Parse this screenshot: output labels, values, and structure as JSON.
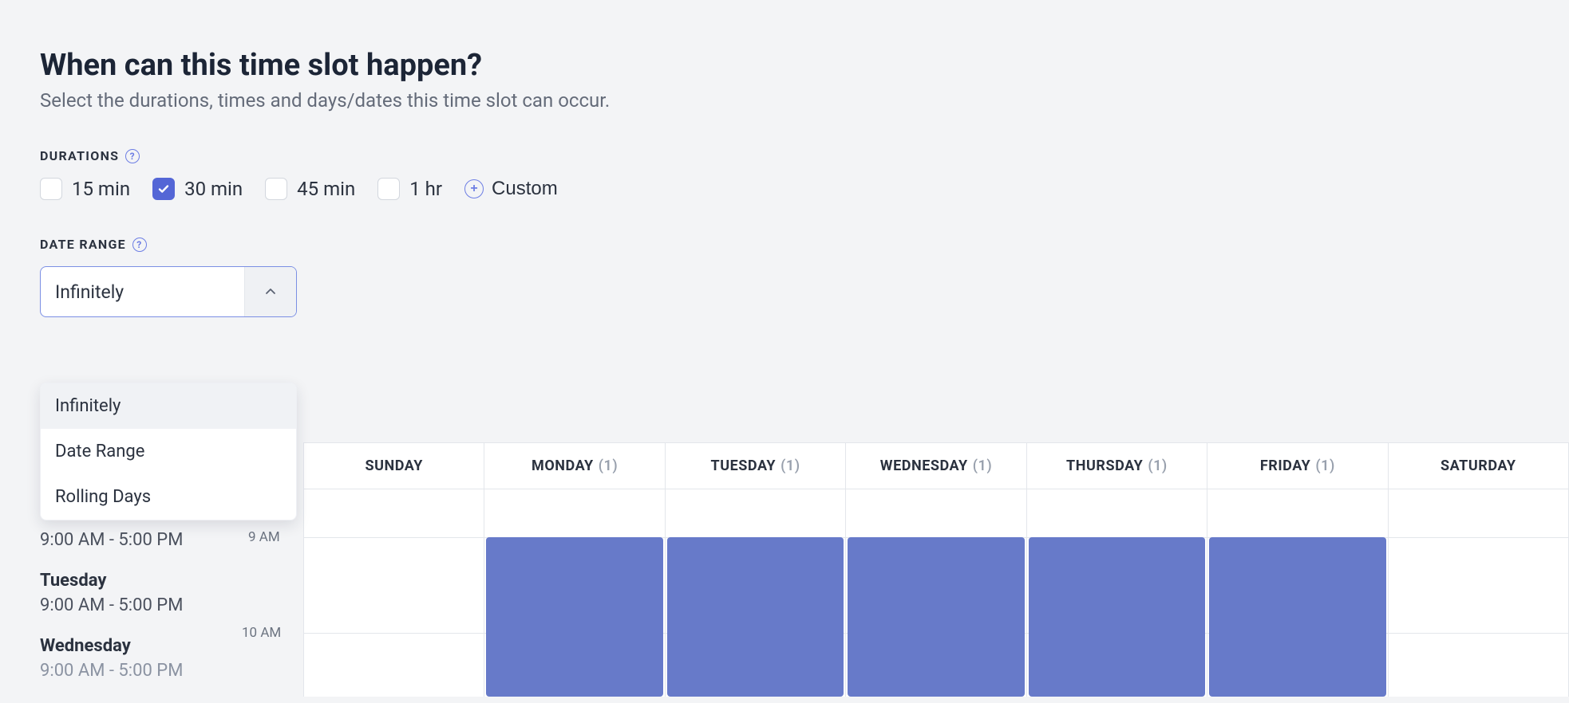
{
  "header": {
    "title": "When can this time slot happen?",
    "subtitle": "Select the durations, times and days/dates this time slot can occur."
  },
  "durations": {
    "label": "DURATIONS",
    "options": [
      {
        "label": "15 min",
        "checked": false
      },
      {
        "label": "30 min",
        "checked": true
      },
      {
        "label": "45 min",
        "checked": false
      },
      {
        "label": "1 hr",
        "checked": false
      }
    ],
    "custom_label": "Custom"
  },
  "date_range": {
    "label": "DATE RANGE",
    "selected": "Infinitely",
    "options": [
      "Infinitely",
      "Date Range",
      "Rolling Days"
    ]
  },
  "sidebar": {
    "days": [
      {
        "name": "",
        "range": "9:00 AM - 5:00 PM"
      },
      {
        "name": "Tuesday",
        "range": "9:00 AM - 5:00 PM"
      },
      {
        "name": "Wednesday",
        "range": "9:00 AM - 5:00 PM"
      }
    ]
  },
  "calendar": {
    "columns": [
      {
        "label": "SUNDAY",
        "count": null,
        "event": false
      },
      {
        "label": "MONDAY",
        "count": "(1)",
        "event": true
      },
      {
        "label": "TUESDAY",
        "count": "(1)",
        "event": true
      },
      {
        "label": "WEDNESDAY",
        "count": "(1)",
        "event": true
      },
      {
        "label": "THURSDAY",
        "count": "(1)",
        "event": true
      },
      {
        "label": "FRIDAY",
        "count": "(1)",
        "event": true
      },
      {
        "label": "SATURDAY",
        "count": null,
        "event": false
      }
    ],
    "hours": {
      "h9": "9 AM",
      "h10": "10 AM"
    }
  }
}
